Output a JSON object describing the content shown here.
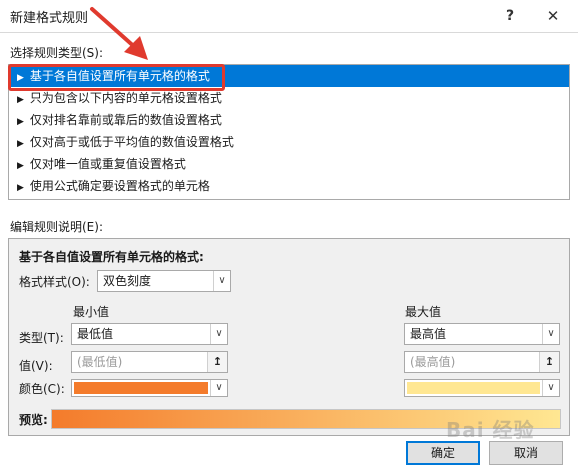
{
  "window": {
    "title": "新建格式规则",
    "help": "?",
    "close": "✕"
  },
  "rule_type_label": "选择规则类型(S):",
  "rules": [
    {
      "label": "基于各自值设置所有单元格的格式",
      "selected": true
    },
    {
      "label": "只为包含以下内容的单元格设置格式",
      "selected": false
    },
    {
      "label": "仅对排名靠前或靠后的数值设置格式",
      "selected": false
    },
    {
      "label": "仅对高于或低于平均值的数值设置格式",
      "selected": false
    },
    {
      "label": "仅对唯一值或重复值设置格式",
      "selected": false
    },
    {
      "label": "使用公式确定要设置格式的单元格",
      "selected": false
    }
  ],
  "edit_label": "编辑规则说明(E):",
  "description": {
    "heading": "基于各自值设置所有单元格的格式:",
    "format_style_label": "格式样式(O):",
    "format_style_value": "双色刻度",
    "min_header": "最小值",
    "max_header": "最大值",
    "type_label": "类型(T):",
    "min_type": "最低值",
    "max_type": "最高值",
    "value_label": "值(V):",
    "min_value_placeholder": "(最低值)",
    "max_value_placeholder": "(最高值)",
    "color_label": "颜色(C):",
    "min_color": "#f47b2b",
    "max_color": "#ffe792",
    "preview_label": "预览:"
  },
  "buttons": {
    "ok": "确定",
    "cancel": "取消"
  },
  "watermark": "Bai 经验"
}
